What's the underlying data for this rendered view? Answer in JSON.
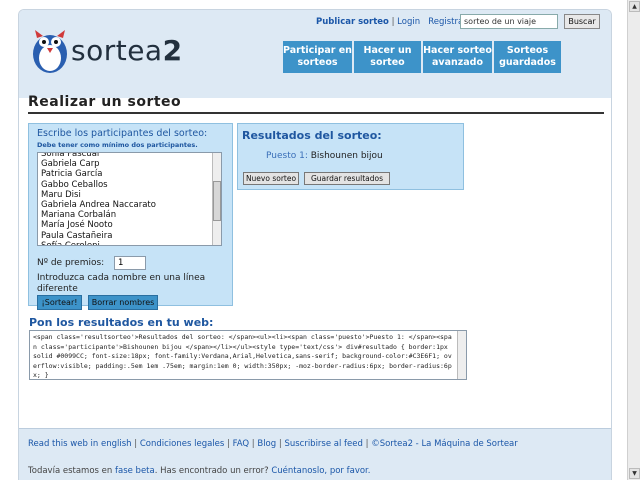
{
  "header": {
    "publish_link": "Publicar sorteo",
    "separator": "|",
    "login_link": "Login",
    "register_link": "Registrar",
    "search_value": "sorteo de un viaje",
    "search_button": "Buscar",
    "logo_text_a": "sortea",
    "logo_text_b": "2"
  },
  "nav": [
    {
      "label": "Participar en sorteos"
    },
    {
      "label": "Hacer un sorteo"
    },
    {
      "label": "Hacer sorteo avanzado"
    },
    {
      "label": "Sorteos guardados"
    }
  ],
  "page_title": "Realizar un sorteo",
  "participants": {
    "title": "Escribe los participantes del sorteo:",
    "subtitle": "Debe tener como mínimo dos participantes.",
    "names": "Sonia Pascual\nGabriela Carp\nPatricia García\nGabbo Ceballos\nMaru Disi\nGabriela Andrea Naccarato\nMariana Corbalán\nMaría José Nooto\nPaula Castañeira\nSofía Ceroleni",
    "prizes_label": "Nº de premios:",
    "prizes_value": "1",
    "intro_text": "Introduzca cada nombre en una línea diferente",
    "draw_button": "¡Sortear!",
    "clear_button": "Borrar nombres"
  },
  "results": {
    "title": "Resultados del sorteo:",
    "position_label": "Puesto 1:",
    "winner": "Bishounen bijou",
    "new_button": "Nuevo sorteo",
    "save_button": "Guardar resultados"
  },
  "embed": {
    "title": "Pon los resultados en tu web:",
    "code": "<span class='resultsorteo'>Resultados del sorteo: </span><ul><li><span class='puesto'>Puesto 1: </span><span class='participante'>Bishounen bijou </span></li></ul><style type='text/css'> div#resultado { border:1px solid #0099CC; font-size:18px; font-family:Verdana,Arial,Helvetica,sans-serif; background-color:#C3E6F1; overflow:visible; padding:.5em 1em .75em; margin:1em 0; width:350px; -moz-border-radius:6px; border-radius:6px; }"
  },
  "footer": {
    "links": [
      "Read this web in english",
      "Condiciones legales",
      "FAQ",
      "Blog",
      "Suscribirse al feed",
      "©Sortea2 - La Máquina de Sortear"
    ],
    "beta_prefix": "Todavía estamos en",
    "beta_link": "fase beta",
    "beta_middle": ". Has encontrado un error?",
    "beta_cta": "Cuéntanoslo, por favor."
  },
  "colors": {
    "accent": "#3d93c9",
    "panel": "#c6e3f7",
    "header_bg": "#dde9f4",
    "title_blue": "#1f57a0"
  }
}
